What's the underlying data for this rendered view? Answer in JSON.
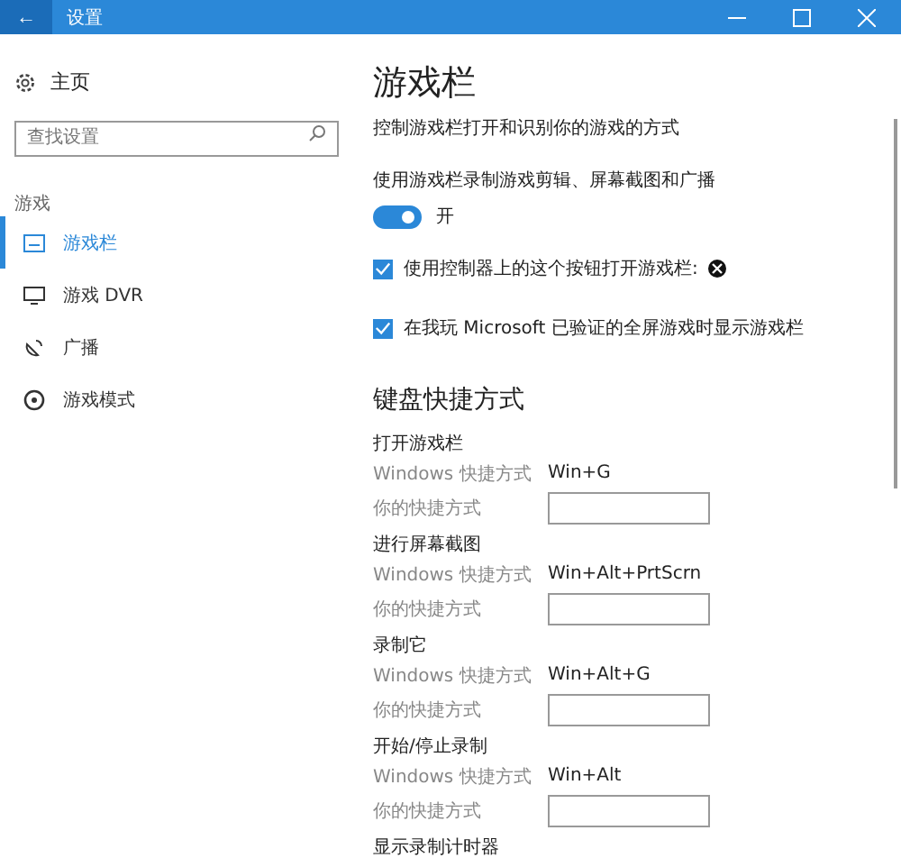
{
  "window": {
    "title": "设置",
    "back": "←"
  },
  "sidebar": {
    "home": "主页",
    "search": {
      "placeholder": "查找设置"
    },
    "section": "游戏",
    "items": [
      {
        "label": "游戏栏",
        "selected": true
      },
      {
        "label": "游戏 DVR",
        "selected": false
      },
      {
        "label": "广播",
        "selected": false
      },
      {
        "label": "游戏模式",
        "selected": false
      }
    ]
  },
  "main": {
    "title": "游戏栏",
    "description": "控制游戏栏打开和识别你的游戏的方式",
    "toggle": {
      "label": "使用游戏栏录制游戏剪辑、屏幕截图和广播",
      "on": true,
      "state_text": "开"
    },
    "checkboxes": [
      {
        "label": "使用控制器上的这个按钮打开游戏栏:",
        "checked": true
      },
      {
        "label": "在我玩 Microsoft 已验证的全屏游戏时显示游戏栏",
        "checked": true
      }
    ],
    "shortcuts_title": "键盘快捷方式",
    "shortcuts": [
      {
        "name": "打开游戏栏",
        "windows_label": "Windows 快捷方式",
        "windows_value": "Win+G",
        "custom_label": "你的快捷方式"
      },
      {
        "name": "进行屏幕截图",
        "windows_label": "Windows 快捷方式",
        "windows_value": "Win+Alt+PrtScrn",
        "custom_label": "你的快捷方式"
      },
      {
        "name": "录制它",
        "windows_label": "Windows 快捷方式",
        "windows_value": "Win+Alt+G",
        "custom_label": "你的快捷方式"
      },
      {
        "name": "开始/停止录制",
        "windows_label": "Windows 快捷方式",
        "windows_value": "Win+Alt",
        "custom_label": "你的快捷方式"
      }
    ],
    "last_heading": "显示录制计时器"
  }
}
